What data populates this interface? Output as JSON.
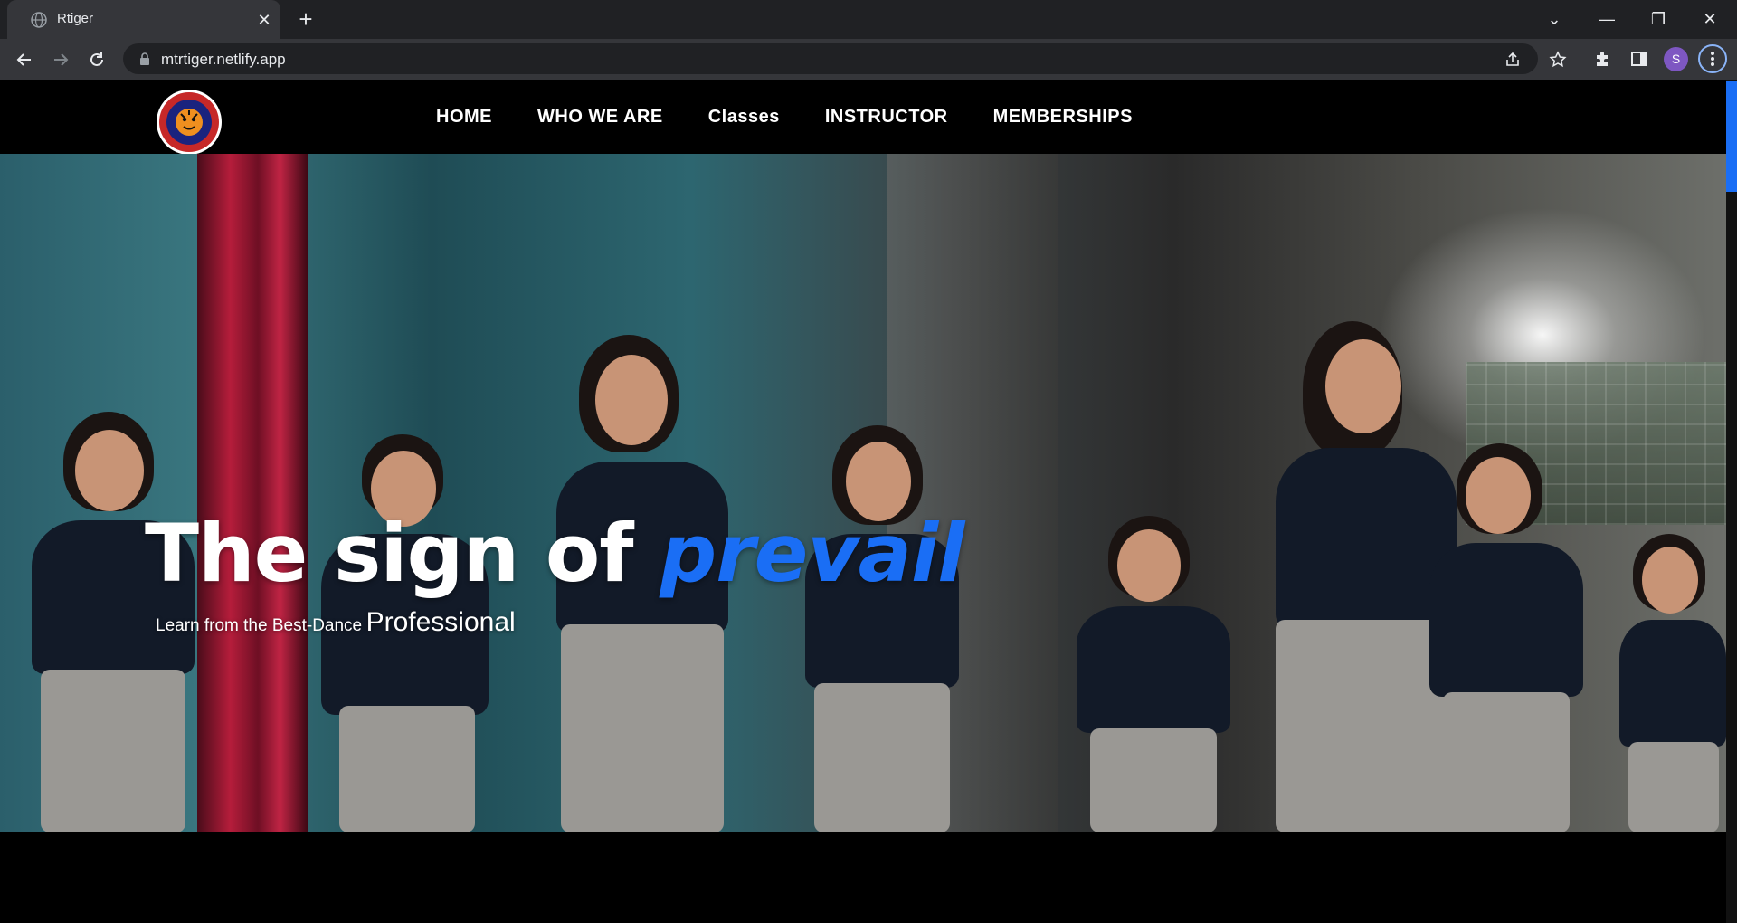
{
  "browser": {
    "tab_title": "Rtiger",
    "tab_close": "✕",
    "new_tab": "+",
    "url": "mtrtiger.netlify.app",
    "profile_initial": "S",
    "window_controls": {
      "list": "⌄",
      "minimize": "—",
      "restore": "❐",
      "close": "✕"
    }
  },
  "site": {
    "logo_alt": "R Tiger Fitness Studio logo",
    "nav": [
      {
        "label": "HOME"
      },
      {
        "label": "WHO WE ARE"
      },
      {
        "label": "Classes"
      },
      {
        "label": "INSTRUCTOR"
      },
      {
        "label": "MEMBERSHIPS"
      }
    ]
  },
  "hero": {
    "title_part1": "The sign of ",
    "title_accent": "prevail",
    "subtitle_small": "Learn from the Best-Dance",
    "subtitle_big": "Professional"
  },
  "colors": {
    "accent": "#1a6ef5",
    "chrome_bg": "#202124",
    "toolbar_bg": "#35363a",
    "profile": "#7e57c2"
  }
}
